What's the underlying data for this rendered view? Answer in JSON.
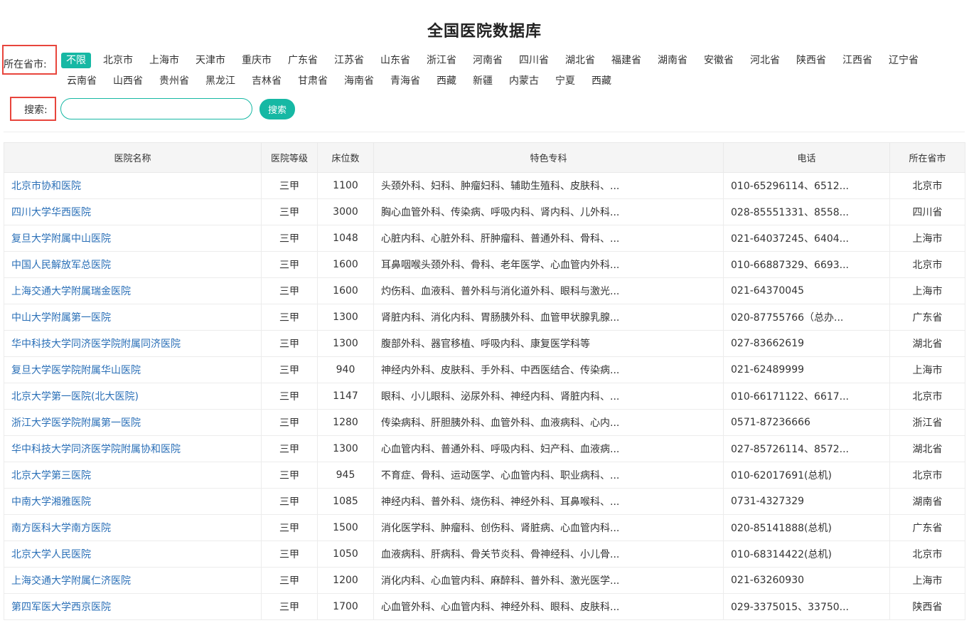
{
  "page": {
    "title": "全国医院数据库"
  },
  "filter": {
    "label": "所在省市:",
    "provinces": [
      "不限",
      "北京市",
      "上海市",
      "天津市",
      "重庆市",
      "广东省",
      "江苏省",
      "山东省",
      "浙江省",
      "河南省",
      "四川省",
      "湖北省",
      "福建省",
      "湖南省",
      "安徽省",
      "河北省",
      "陕西省",
      "江西省",
      "辽宁省",
      "云南省",
      "山西省",
      "贵州省",
      "黑龙江",
      "吉林省",
      "甘肃省",
      "海南省",
      "青海省",
      "西藏",
      "新疆",
      "内蒙古",
      "宁夏",
      "西藏"
    ],
    "selected": "不限"
  },
  "search": {
    "label": "搜索:",
    "value": "",
    "placeholder": "",
    "button_label": "搜索"
  },
  "table": {
    "headers": [
      "医院名称",
      "医院等级",
      "床位数",
      "特色专科",
      "电话",
      "所在省市"
    ],
    "rows": [
      [
        "北京市协和医院",
        "三甲",
        "1100",
        "头颈外科、妇科、肿瘤妇科、辅助生殖科、皮肤科、...",
        "010-65296114、6512...",
        "北京市"
      ],
      [
        "四川大学华西医院",
        "三甲",
        "3000",
        "胸心血管外科、传染病、呼吸内科、肾内科、儿外科...",
        "028-85551331、8558...",
        "四川省"
      ],
      [
        "复旦大学附属中山医院",
        "三甲",
        "1048",
        "心脏内科、心脏外科、肝肿瘤科、普通外科、骨科、...",
        "021-64037245、6404...",
        "上海市"
      ],
      [
        "中国人民解放军总医院",
        "三甲",
        "1600",
        "耳鼻咽喉头颈外科、骨科、老年医学、心血管内外科...",
        "010-66887329、6693...",
        "北京市"
      ],
      [
        "上海交通大学附属瑞金医院",
        "三甲",
        "1600",
        "灼伤科、血液科、普外科与消化道外科、眼科与激光...",
        "021-64370045",
        "上海市"
      ],
      [
        "中山大学附属第一医院",
        "三甲",
        "1300",
        "肾脏内科、消化内科、胃肠胰外科、血管甲状腺乳腺...",
        "020-87755766（总办...",
        "广东省"
      ],
      [
        "华中科技大学同济医学院附属同济医院",
        "三甲",
        "1300",
        "腹部外科、器官移植、呼吸内科、康复医学科等",
        "027-83662619",
        "湖北省"
      ],
      [
        "复旦大学医学院附属华山医院",
        "三甲",
        "940",
        "神经内外科、皮肤科、手外科、中西医结合、传染病...",
        "021-62489999",
        "上海市"
      ],
      [
        "北京大学第一医院(北大医院)",
        "三甲",
        "1147",
        "眼科、小儿眼科、泌尿外科、神经内科、肾脏内科、...",
        "010-66171122、6617...",
        "北京市"
      ],
      [
        "浙江大学医学院附属第一医院",
        "三甲",
        "1280",
        "传染病科、肝胆胰外科、血管外科、血液病科、心内...",
        "0571-87236666",
        "浙江省"
      ],
      [
        "华中科技大学同济医学院附属协和医院",
        "三甲",
        "1300",
        "心血管内科、普通外科、呼吸内科、妇产科、血液病...",
        "027-85726114、8572...",
        "湖北省"
      ],
      [
        "北京大学第三医院",
        "三甲",
        "945",
        "不育症、骨科、运动医学、心血管内科、职业病科、...",
        "010-62017691(总机)",
        "北京市"
      ],
      [
        "中南大学湘雅医院",
        "三甲",
        "1085",
        "神经内科、普外科、烧伤科、神经外科、耳鼻喉科、...",
        "0731-4327329",
        "湖南省"
      ],
      [
        "南方医科大学南方医院",
        "三甲",
        "1500",
        "消化医学科、肿瘤科、创伤科、肾脏病、心血管内科...",
        "020-85141888(总机)",
        "广东省"
      ],
      [
        "北京大学人民医院",
        "三甲",
        "1050",
        "血液病科、肝病科、骨关节炎科、骨神经科、小儿骨...",
        "010-68314422(总机)",
        "北京市"
      ],
      [
        "上海交通大学附属仁济医院",
        "三甲",
        "1200",
        "消化内科、心血管内科、麻醉科、普外科、激光医学...",
        "021-63260930",
        "上海市"
      ],
      [
        "第四军医大学西京医院",
        "三甲",
        "1700",
        "心血管外科、心血管内科、神经外科、眼科、皮肤科...",
        "029-3375015、33750...",
        "陕西省"
      ]
    ]
  },
  "colors": {
    "accent": "#16b8a4",
    "link": "#2a6fb7",
    "highlight_box": "#e8453c"
  }
}
